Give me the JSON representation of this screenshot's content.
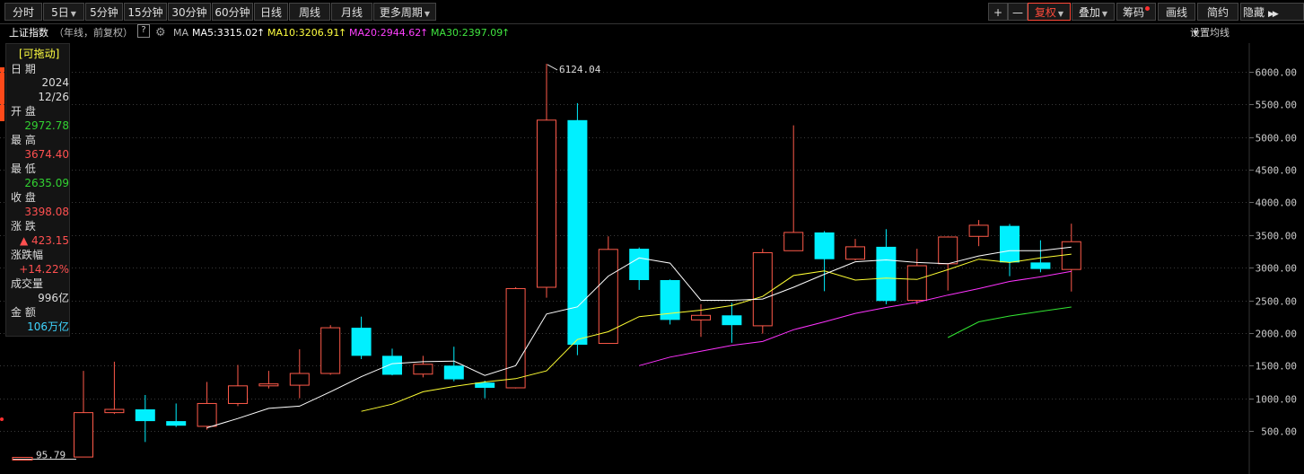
{
  "toolbar": {
    "periods": [
      {
        "label": "分时",
        "dropdown": false
      },
      {
        "label": "5日",
        "dropdown": true
      },
      {
        "label": "5分钟",
        "dropdown": false
      },
      {
        "label": "15分钟",
        "dropdown": false
      },
      {
        "label": "30分钟",
        "dropdown": false
      },
      {
        "label": "60分钟",
        "dropdown": false
      },
      {
        "label": "日线",
        "dropdown": false
      },
      {
        "label": "周线",
        "dropdown": false
      },
      {
        "label": "月线",
        "dropdown": false
      },
      {
        "label": "更多周期",
        "dropdown": true
      }
    ],
    "zoom_in": "+",
    "zoom_out": "—",
    "right": {
      "fuquan": "复权",
      "overlay": "叠加",
      "chips": "筹码",
      "draw": "画线",
      "simple": "简约",
      "hide": "隐藏"
    }
  },
  "info": {
    "index_name": "上证指数",
    "subtitle": "（年线，前复权）",
    "help": "?",
    "ma_label": "MA",
    "ma5": "MA5:3315.02",
    "ma10": "MA10:3206.91",
    "ma20": "MA20:2944.62",
    "ma30": "MA30:2397.09",
    "setting": "设置均线"
  },
  "panel": {
    "title": "[可拖动]",
    "date_label": "日 期",
    "year": "2024",
    "date": "12/26",
    "open_label": "开 盘",
    "open": "2972.78",
    "high_label": "最 高",
    "high": "3674.40",
    "low_label": "最 低",
    "low": "2635.09",
    "close_label": "收 盘",
    "close": "3398.08",
    "change_label": "涨 跌",
    "change": "▲ 423.15",
    "pct_label": "涨跌幅",
    "pct": "+14.22%",
    "volume_label": "成交量",
    "volume": "996亿",
    "amount_label": "金 额",
    "amount": "106万亿"
  },
  "colors": {
    "up": "#ff5a4a",
    "down": "#00f0ff",
    "ma5": "#ffffff",
    "ma10": "#ffff33",
    "ma20": "#ff33ff",
    "ma30": "#33e633",
    "grid": "#3a3a3a",
    "axis_text": "#cccccc"
  },
  "chart_data": {
    "type": "candlestick",
    "title": "上证指数",
    "ylim": [
      0,
      6300
    ],
    "y_ticks": [
      500,
      1000,
      1500,
      2000,
      2500,
      3000,
      3500,
      4000,
      4500,
      5000,
      5500,
      6000
    ],
    "y_tick_labels": [
      "500.00",
      "1000.00",
      "1500.00",
      "2000.00",
      "2500.00",
      "3000.00",
      "3500.00",
      "4000.00",
      "4500.00",
      "5000.00",
      "5500.00",
      "6000.00"
    ],
    "annotations": {
      "max_label": "6124.04",
      "min_label": "95.79"
    },
    "candles": [
      {
        "open": 100,
        "close": 780,
        "high": 1420,
        "low": 95
      },
      {
        "open": 780,
        "close": 830,
        "high": 1560,
        "low": 760
      },
      {
        "open": 830,
        "close": 650,
        "high": 1050,
        "low": 330
      },
      {
        "open": 650,
        "close": 580,
        "high": 920,
        "low": 560
      },
      {
        "open": 570,
        "close": 920,
        "high": 1250,
        "low": 520
      },
      {
        "open": 920,
        "close": 1190,
        "high": 1510,
        "low": 880
      },
      {
        "open": 1190,
        "close": 1220,
        "high": 1420,
        "low": 1150
      },
      {
        "open": 1200,
        "close": 1380,
        "high": 1750,
        "low": 1000
      },
      {
        "open": 1380,
        "close": 2080,
        "high": 2120,
        "low": 1360
      },
      {
        "open": 2080,
        "close": 1650,
        "high": 2250,
        "low": 1600
      },
      {
        "open": 1650,
        "close": 1360,
        "high": 1760,
        "low": 1350
      },
      {
        "open": 1370,
        "close": 1520,
        "high": 1650,
        "low": 1320
      },
      {
        "open": 1500,
        "close": 1290,
        "high": 1790,
        "low": 1260
      },
      {
        "open": 1240,
        "close": 1160,
        "high": 1270,
        "low": 1000
      },
      {
        "open": 1160,
        "close": 2680,
        "high": 2700,
        "low": 1150
      },
      {
        "open": 2700,
        "close": 5260,
        "high": 6124,
        "low": 2540
      },
      {
        "open": 5260,
        "close": 1820,
        "high": 5520,
        "low": 1660
      },
      {
        "open": 1840,
        "close": 3280,
        "high": 3480,
        "low": 1840
      },
      {
        "open": 3290,
        "close": 2810,
        "high": 3310,
        "low": 2660
      },
      {
        "open": 2810,
        "close": 2200,
        "high": 2820,
        "low": 2130
      },
      {
        "open": 2200,
        "close": 2270,
        "high": 2440,
        "low": 1940
      },
      {
        "open": 2270,
        "close": 2120,
        "high": 2460,
        "low": 1850
      },
      {
        "open": 2110,
        "close": 3230,
        "high": 3290,
        "low": 1990
      },
      {
        "open": 3260,
        "close": 3540,
        "high": 5180,
        "low": 3260
      },
      {
        "open": 3540,
        "close": 3130,
        "high": 3560,
        "low": 2640
      },
      {
        "open": 3130,
        "close": 3320,
        "high": 3440,
        "low": 3110
      },
      {
        "open": 3320,
        "close": 2490,
        "high": 3590,
        "low": 2440
      },
      {
        "open": 2500,
        "close": 3030,
        "high": 3290,
        "low": 2440
      },
      {
        "open": 3060,
        "close": 3470,
        "high": 3480,
        "low": 2650
      },
      {
        "open": 3480,
        "close": 3650,
        "high": 3730,
        "low": 3330
      },
      {
        "open": 3640,
        "close": 3080,
        "high": 3670,
        "low": 2870
      },
      {
        "open": 3080,
        "close": 2980,
        "high": 3420,
        "low": 2930
      },
      {
        "open": 2973,
        "close": 3398,
        "high": 3674,
        "low": 2635
      }
    ],
    "ma5": [
      null,
      null,
      null,
      null,
      548,
      690,
      845,
      880,
      1100,
      1330,
      1530,
      1560,
      1570,
      1350,
      1500,
      2290,
      2400,
      2870,
      3150,
      3070,
      2500,
      2500,
      2520,
      2700,
      2900,
      3090,
      3120,
      3080,
      3060,
      3180,
      3260,
      3260,
      3315
    ],
    "ma10": [
      null,
      null,
      null,
      null,
      null,
      null,
      null,
      null,
      null,
      800,
      910,
      1100,
      1180,
      1250,
      1300,
      1420,
      1900,
      2020,
      2250,
      2300,
      2350,
      2420,
      2560,
      2880,
      2950,
      2810,
      2840,
      2820,
      2970,
      3130,
      3080,
      3150,
      3207
    ],
    "ma20": [
      null,
      null,
      null,
      null,
      null,
      null,
      null,
      null,
      null,
      null,
      null,
      null,
      null,
      null,
      null,
      null,
      null,
      null,
      1500,
      1630,
      1720,
      1810,
      1870,
      2050,
      2170,
      2300,
      2390,
      2470,
      2580,
      2680,
      2790,
      2860,
      2945
    ],
    "ma30": [
      null,
      null,
      null,
      null,
      null,
      null,
      null,
      null,
      null,
      null,
      null,
      null,
      null,
      null,
      null,
      null,
      null,
      null,
      null,
      null,
      null,
      null,
      null,
      null,
      null,
      null,
      null,
      null,
      1930,
      2170,
      2260,
      2330,
      2397
    ]
  }
}
